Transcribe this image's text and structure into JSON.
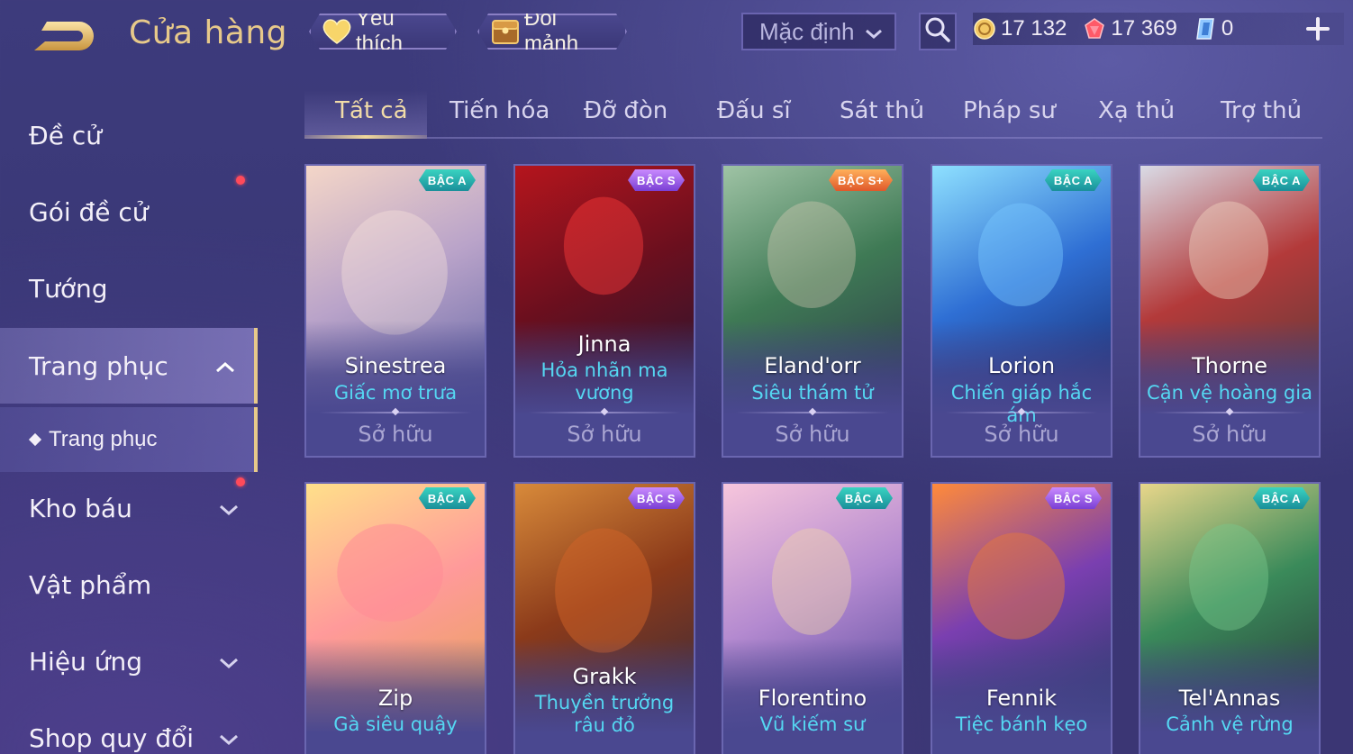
{
  "header": {
    "title": "Cửa hàng",
    "favorite_label": "Yêu thích",
    "fragment_label": "Đổi mảnh",
    "sort_value": "Mặc định",
    "currencies": {
      "gold": "17 132",
      "voucher": "17 369",
      "diamond": "0"
    }
  },
  "sidebar": {
    "items": [
      {
        "label": "Đề cử"
      },
      {
        "label": "Gói đề cử"
      },
      {
        "label": "Tướng"
      },
      {
        "label": "Trang phục"
      },
      {
        "label": "Kho báu"
      },
      {
        "label": "Vật phẩm"
      },
      {
        "label": "Hiệu ứng"
      },
      {
        "label": "Shop quy đổi"
      }
    ],
    "sub_item": "Trang phục"
  },
  "tabs": [
    "Tất cả",
    "Tiến hóa",
    "Đỡ đòn",
    "Đấu sĩ",
    "Sát thủ",
    "Pháp sư",
    "Xạ thủ",
    "Trợ thủ"
  ],
  "cards": [
    {
      "hero": "Sinestrea",
      "skin": "Giấc mơ trưa",
      "rank": "BẬC A",
      "status": "Sở hữu",
      "palette": [
        "#f4d6c8",
        "#b9a3c9",
        "#6a6aa8"
      ]
    },
    {
      "hero": "Jinna",
      "skin": "Hỏa nhãn ma vương",
      "rank": "BẬC S",
      "status": "Sở hữu",
      "palette": [
        "#b5151d",
        "#6b0f1e",
        "#2a1630"
      ]
    },
    {
      "hero": "Eland'orr",
      "skin": "Siêu thám tử",
      "rank": "BẬC S+",
      "status": "Sở hữu",
      "palette": [
        "#9fc3a5",
        "#3f7a55",
        "#2d3d4a"
      ]
    },
    {
      "hero": "Lorion",
      "skin": "Chiến giáp hắc ám",
      "rank": "BẬC A",
      "status": "Sở hữu",
      "palette": [
        "#8ee0ff",
        "#2f6fd4",
        "#1a2c6e"
      ]
    },
    {
      "hero": "Thorne",
      "skin": "Cận vệ hoàng gia",
      "rank": "BẬC A",
      "status": "Sở hữu",
      "palette": [
        "#d9dbe6",
        "#b33a3a",
        "#5b3a3a"
      ]
    },
    {
      "hero": "Zip",
      "skin": "Gà siêu quậy",
      "rank": "BẬC A",
      "status": "",
      "palette": [
        "#ffe08a",
        "#ff9a9a",
        "#e8a35a"
      ]
    },
    {
      "hero": "Grakk",
      "skin": "Thuyền trưởng râu đỏ",
      "rank": "BẬC S",
      "status": "",
      "palette": [
        "#d88a3a",
        "#8b3a1a",
        "#3a2a3a"
      ]
    },
    {
      "hero": "Florentino",
      "skin": "Vũ kiếm sư",
      "rank": "BẬC A",
      "status": "",
      "palette": [
        "#f7c6dc",
        "#b48ad0",
        "#5a4aa0"
      ]
    },
    {
      "hero": "Fennik",
      "skin": "Tiệc bánh kẹo",
      "rank": "BẬC S",
      "status": "",
      "palette": [
        "#ff8a3a",
        "#7a3fb0",
        "#2a3a6a"
      ]
    },
    {
      "hero": "Tel'Annas",
      "skin": "Cảnh vệ rừng",
      "rank": "BẬC A",
      "status": "",
      "palette": [
        "#e8d68a",
        "#3a8a5a",
        "#2a3a3a"
      ]
    }
  ]
}
